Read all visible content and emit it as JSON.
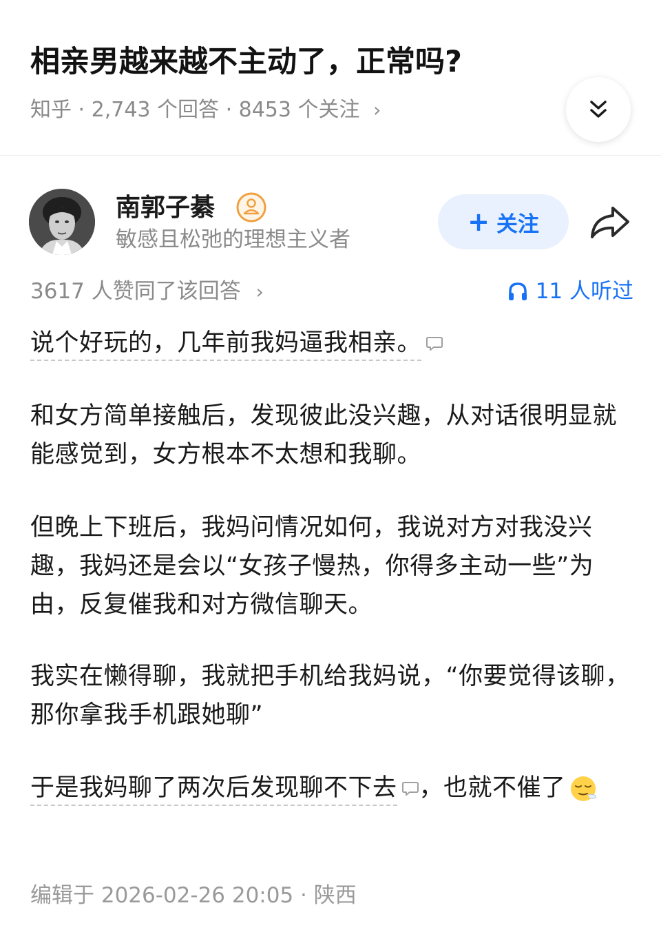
{
  "question": {
    "title": "相亲男越来越不主动了，正常吗?",
    "meta": "知乎 · 2,743 个回答 · 8453 个关注",
    "meta_chevron": "›",
    "collapse_icon": "double-chevron-down-icon"
  },
  "author": {
    "name": "南郭子綦",
    "bio": "敏感且松弛的理想主义者",
    "follow_plus": "+",
    "follow_label": "关注",
    "badge_icon": "user-badge-icon",
    "share_icon": "share-arrow-icon"
  },
  "stats": {
    "votes": "3617 人赞同了该回答",
    "votes_chevron": "›",
    "listens": "11 人听过"
  },
  "answer": {
    "p1_dotted": "说个好玩的，几年前我妈逼我相亲。",
    "p2": "和女方简单接触后，发现彼此没兴趣，从对话很明显就能感觉到，女方根本不太想和我聊。",
    "p3": "但晚上下班后，我妈问情况如何，我说对方对我没兴趣，我妈还是会以“女孩子慢热，你得多主动一些”为由，反复催我和对方微信聊天。",
    "p4": "我实在懒得聊，我就把手机给我妈说，“你要觉得该聊，那你拿我手机跟她聊”",
    "p5_dotted": "于是我妈聊了两次后发现聊不下去",
    "p5_rest": "，也就不催了"
  },
  "edit_info": "编辑于 2026-02-26 20:05 · 陕西",
  "colors": {
    "accent": "#1772f6",
    "follow_bg": "#e8f1fd",
    "muted": "#8a8a8a",
    "badge": "#f0a040"
  }
}
